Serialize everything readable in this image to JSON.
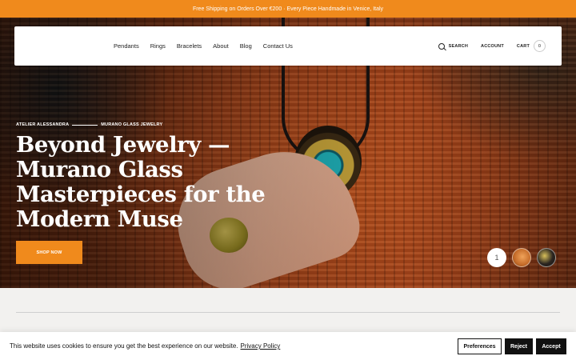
{
  "promo_bar": {
    "text": "Free Shipping on Orders Over €200 · Every Piece Handmade in Venice, Italy"
  },
  "nav": {
    "links": [
      "Pendants",
      "Rings",
      "Bracelets",
      "About",
      "Blog",
      "Contact Us"
    ],
    "search_label": "SEARCH",
    "account_label": "ACCOUNT",
    "cart_label": "CART",
    "cart_count": "0"
  },
  "hero": {
    "eyebrow_left": "ATELIER ALESSANDRA",
    "eyebrow_right": "MURANO GLASS JEWELRY",
    "headline": "Beyond Jewelry — Murano Glass Masterpieces for the Modern Muse",
    "cta_label": "SHOP NOW",
    "slider": {
      "current": "1",
      "total_slides": 3
    }
  },
  "cookie_banner": {
    "text": "This website uses cookies to ensure you get the best experience on our website.",
    "link_text": "Privacy Policy",
    "buttons": {
      "preferences": "Preferences",
      "reject": "Reject",
      "accept": "Accept"
    }
  },
  "colors": {
    "accent": "#f08a1c",
    "dark": "#111111",
    "page_bg": "#f2f1ef"
  }
}
